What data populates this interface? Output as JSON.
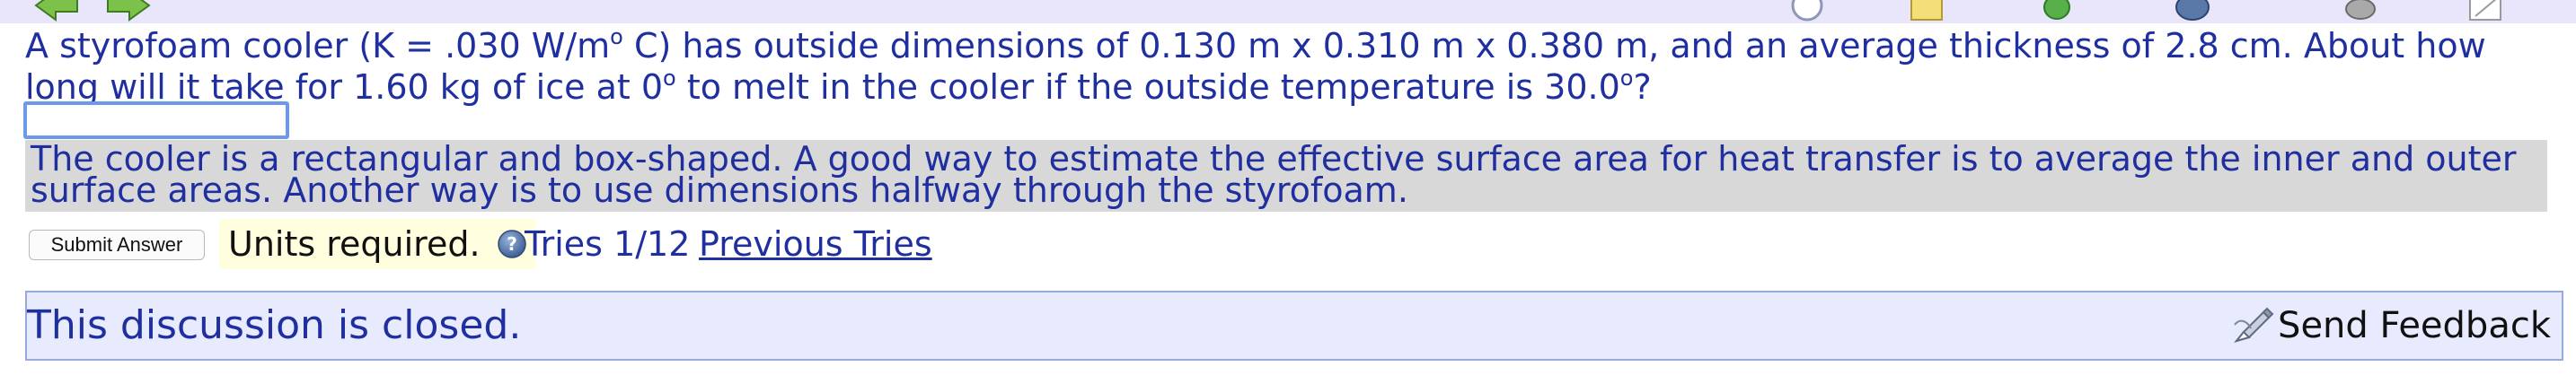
{
  "question": {
    "part1": "A styrofoam cooler (K = .030 W/m",
    "deg1": "o",
    "part2": " C) has outside dimensions of 0.130 m x 0.310 m x 0.380 m, and an average thickness of 2.8 cm. About how long will it take for 1.60 kg of ice at 0",
    "deg2": "o",
    "part3": " to melt in the cooler if the outside temperature is 30.0",
    "deg3": "o",
    "part4": "?"
  },
  "answer": {
    "value": ""
  },
  "hint": {
    "text": "The cooler is a rectangular and box-shaped. A good way to estimate the effective surface area for heat transfer is to average the inner and outer surface areas. Another way is to use dimensions halfway through the styrofoam."
  },
  "controls": {
    "submit_label": "Submit Answer",
    "units_label": "Units required.",
    "help_glyph": "?",
    "tries_text": "Tries 1/12",
    "previous_tries_label": "Previous Tries"
  },
  "discussion": {
    "closed_text": "This discussion is closed.",
    "feedback_label": "Send Feedback"
  },
  "colors": {
    "text_blue": "#1f2fa0",
    "hint_bg": "#d8d8d8",
    "units_bg": "#ffffe0",
    "discussion_bg": "#e8eafd",
    "discussion_border": "#9aaadf",
    "input_focus": "#6d9ae8"
  }
}
